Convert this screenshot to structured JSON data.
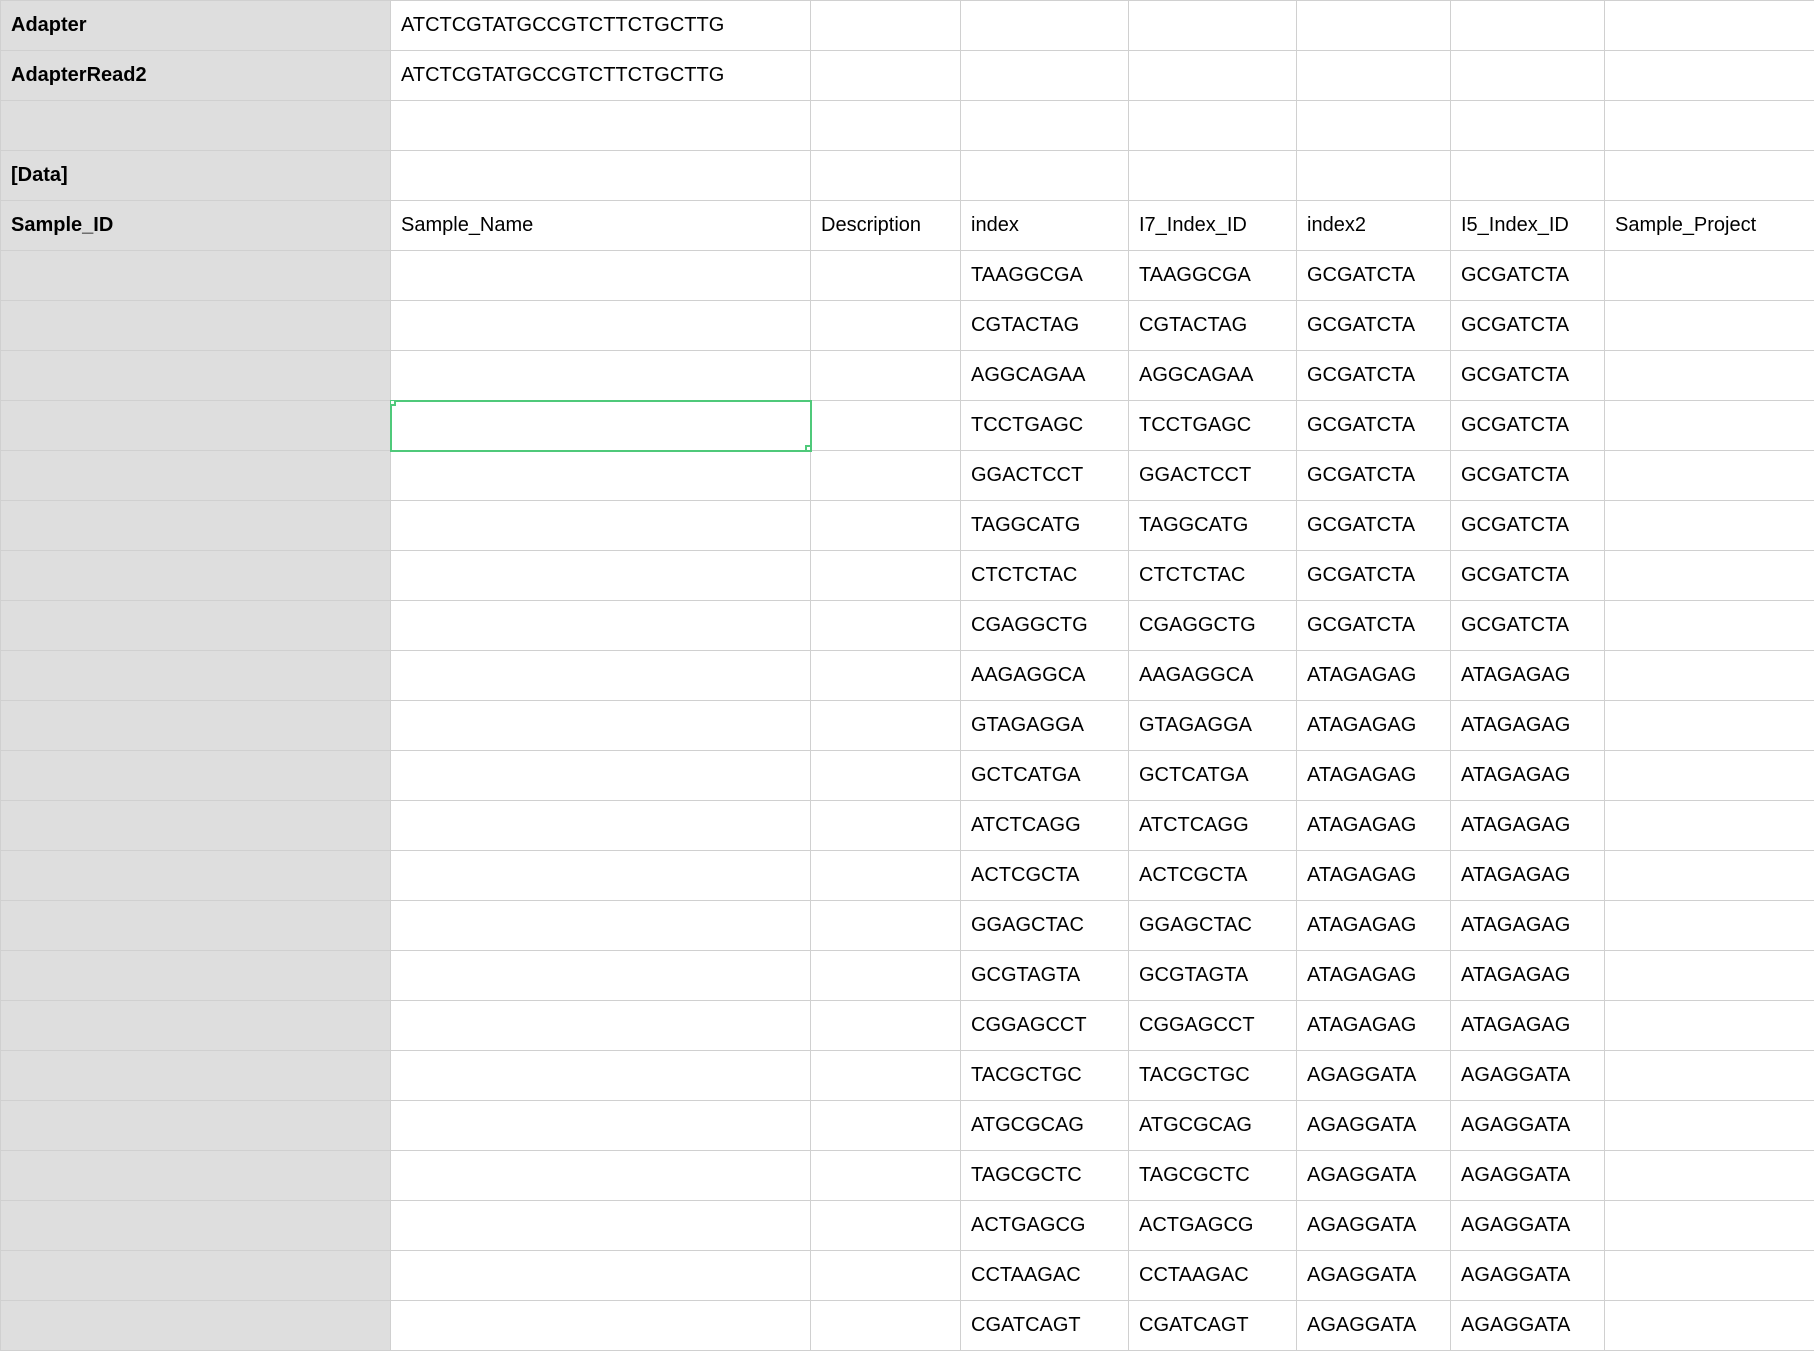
{
  "rows": [
    {
      "a": "Adapter",
      "aBold": true,
      "b": "ATCTCGTATGCCGTCTTCTGCTTG",
      "c": "",
      "d": "",
      "e": "",
      "f": "",
      "g": "",
      "h": ""
    },
    {
      "a": "AdapterRead2",
      "aBold": true,
      "b": "ATCTCGTATGCCGTCTTCTGCTTG",
      "c": "",
      "d": "",
      "e": "",
      "f": "",
      "g": "",
      "h": ""
    },
    {
      "a": "",
      "aBold": false,
      "b": "",
      "c": "",
      "d": "",
      "e": "",
      "f": "",
      "g": "",
      "h": ""
    },
    {
      "a": "[Data]",
      "aBold": true,
      "b": "",
      "c": "",
      "d": "",
      "e": "",
      "f": "",
      "g": "",
      "h": ""
    },
    {
      "a": "Sample_ID",
      "aBold": true,
      "b": "Sample_Name",
      "c": "Description",
      "d": "index",
      "e": "I7_Index_ID",
      "f": "index2",
      "g": "I5_Index_ID",
      "h": "Sample_Project"
    },
    {
      "a": "",
      "aBold": false,
      "b": "",
      "c": "",
      "d": "TAAGGCGA",
      "e": "TAAGGCGA",
      "f": "GCGATCTA",
      "g": "GCGATCTA",
      "h": ""
    },
    {
      "a": "",
      "aBold": false,
      "b": "",
      "c": "",
      "d": "CGTACTAG",
      "e": "CGTACTAG",
      "f": "GCGATCTA",
      "g": "GCGATCTA",
      "h": ""
    },
    {
      "a": "",
      "aBold": false,
      "b": "",
      "c": "",
      "d": "AGGCAGAA",
      "e": "AGGCAGAA",
      "f": "GCGATCTA",
      "g": "GCGATCTA",
      "h": ""
    },
    {
      "a": "",
      "aBold": false,
      "b": "",
      "bSelected": true,
      "c": "",
      "d": "TCCTGAGC",
      "e": "TCCTGAGC",
      "f": "GCGATCTA",
      "g": "GCGATCTA",
      "h": ""
    },
    {
      "a": "",
      "aBold": false,
      "b": "",
      "c": "",
      "d": "GGACTCCT",
      "e": "GGACTCCT",
      "f": "GCGATCTA",
      "g": "GCGATCTA",
      "h": ""
    },
    {
      "a": "",
      "aBold": false,
      "b": "",
      "c": "",
      "d": "TAGGCATG",
      "e": "TAGGCATG",
      "f": "GCGATCTA",
      "g": "GCGATCTA",
      "h": ""
    },
    {
      "a": "",
      "aBold": false,
      "b": "",
      "c": "",
      "d": "CTCTCTAC",
      "e": "CTCTCTAC",
      "f": "GCGATCTA",
      "g": "GCGATCTA",
      "h": ""
    },
    {
      "a": "",
      "aBold": false,
      "b": "",
      "c": "",
      "d": "CGAGGCTG",
      "e": "CGAGGCTG",
      "f": "GCGATCTA",
      "g": "GCGATCTA",
      "h": ""
    },
    {
      "a": "",
      "aBold": false,
      "b": "",
      "c": "",
      "d": "AAGAGGCA",
      "e": "AAGAGGCA",
      "f": "ATAGAGAG",
      "g": "ATAGAGAG",
      "h": ""
    },
    {
      "a": "",
      "aBold": false,
      "b": "",
      "c": "",
      "d": "GTAGAGGA",
      "e": "GTAGAGGA",
      "f": "ATAGAGAG",
      "g": "ATAGAGAG",
      "h": ""
    },
    {
      "a": "",
      "aBold": false,
      "b": "",
      "c": "",
      "d": "GCTCATGA",
      "e": "GCTCATGA",
      "f": "ATAGAGAG",
      "g": "ATAGAGAG",
      "h": ""
    },
    {
      "a": "",
      "aBold": false,
      "b": "",
      "c": "",
      "d": "ATCTCAGG",
      "e": "ATCTCAGG",
      "f": "ATAGAGAG",
      "g": "ATAGAGAG",
      "h": ""
    },
    {
      "a": "",
      "aBold": false,
      "b": "",
      "c": "",
      "d": "ACTCGCTA",
      "e": "ACTCGCTA",
      "f": "ATAGAGAG",
      "g": "ATAGAGAG",
      "h": ""
    },
    {
      "a": "",
      "aBold": false,
      "b": "",
      "c": "",
      "d": "GGAGCTAC",
      "e": "GGAGCTAC",
      "f": "ATAGAGAG",
      "g": "ATAGAGAG",
      "h": ""
    },
    {
      "a": "",
      "aBold": false,
      "b": "",
      "c": "",
      "d": "GCGTAGTA",
      "e": "GCGTAGTA",
      "f": "ATAGAGAG",
      "g": "ATAGAGAG",
      "h": ""
    },
    {
      "a": "",
      "aBold": false,
      "b": "",
      "c": "",
      "d": "CGGAGCCT",
      "e": "CGGAGCCT",
      "f": "ATAGAGAG",
      "g": "ATAGAGAG",
      "h": ""
    },
    {
      "a": "",
      "aBold": false,
      "b": "",
      "c": "",
      "d": "TACGCTGC",
      "e": "TACGCTGC",
      "f": "AGAGGATA",
      "g": "AGAGGATA",
      "h": ""
    },
    {
      "a": "",
      "aBold": false,
      "b": "",
      "c": "",
      "d": "ATGCGCAG",
      "e": "ATGCGCAG",
      "f": "AGAGGATA",
      "g": "AGAGGATA",
      "h": ""
    },
    {
      "a": "",
      "aBold": false,
      "b": "",
      "c": "",
      "d": "TAGCGCTC",
      "e": "TAGCGCTC",
      "f": "AGAGGATA",
      "g": "AGAGGATA",
      "h": ""
    },
    {
      "a": "",
      "aBold": false,
      "b": "",
      "c": "",
      "d": "ACTGAGCG",
      "e": "ACTGAGCG",
      "f": "AGAGGATA",
      "g": "AGAGGATA",
      "h": ""
    },
    {
      "a": "",
      "aBold": false,
      "b": "",
      "c": "",
      "d": "CCTAAGAC",
      "e": "CCTAAGAC",
      "f": "AGAGGATA",
      "g": "AGAGGATA",
      "h": ""
    },
    {
      "a": "",
      "aBold": false,
      "b": "",
      "c": "",
      "d": "CGATCAGT",
      "e": "CGATCAGT",
      "f": "AGAGGATA",
      "g": "AGAGGATA",
      "h": ""
    }
  ]
}
